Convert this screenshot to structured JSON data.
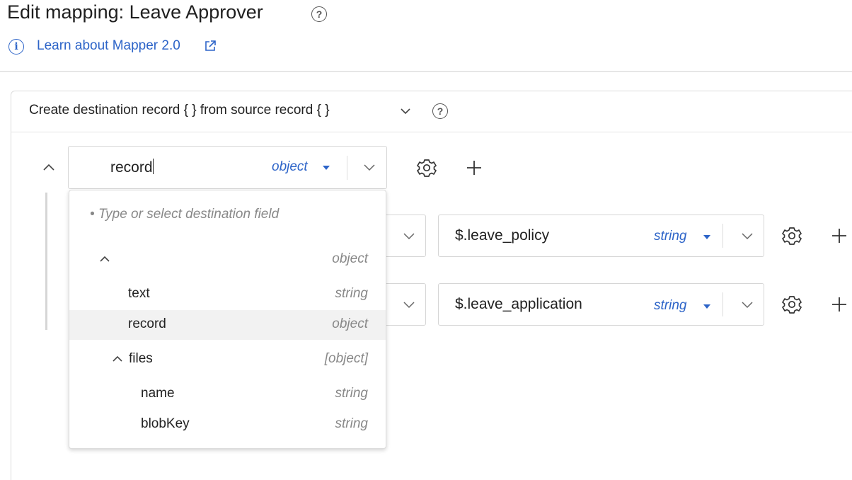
{
  "header": {
    "title": "Edit mapping: Leave Approver",
    "help_glyph": "?",
    "info_glyph": "i",
    "learn_link": "Learn about Mapper 2.0"
  },
  "mapping_mode": {
    "label": "Create destination record { } from source record { }",
    "help_glyph": "?"
  },
  "root_row": {
    "field_value": "record",
    "type": "object"
  },
  "rows": [
    {
      "source_value": "$.leave_policy",
      "type": "string"
    },
    {
      "source_value": "$.leave_application",
      "type": "string"
    }
  ],
  "dropdown": {
    "hint": "Type or select destination field",
    "bullet": "•",
    "items": [
      {
        "name": "",
        "type": "object"
      },
      {
        "name": "text",
        "type": "string"
      },
      {
        "name": "record",
        "type": "object"
      },
      {
        "name": "files",
        "type": "[object]"
      },
      {
        "name": "name",
        "type": "string"
      },
      {
        "name": "blobKey",
        "type": "string"
      }
    ]
  },
  "colors": {
    "accent": "#2d64c8",
    "border": "#d6d6d6",
    "highlight": "#f2f2f2"
  }
}
